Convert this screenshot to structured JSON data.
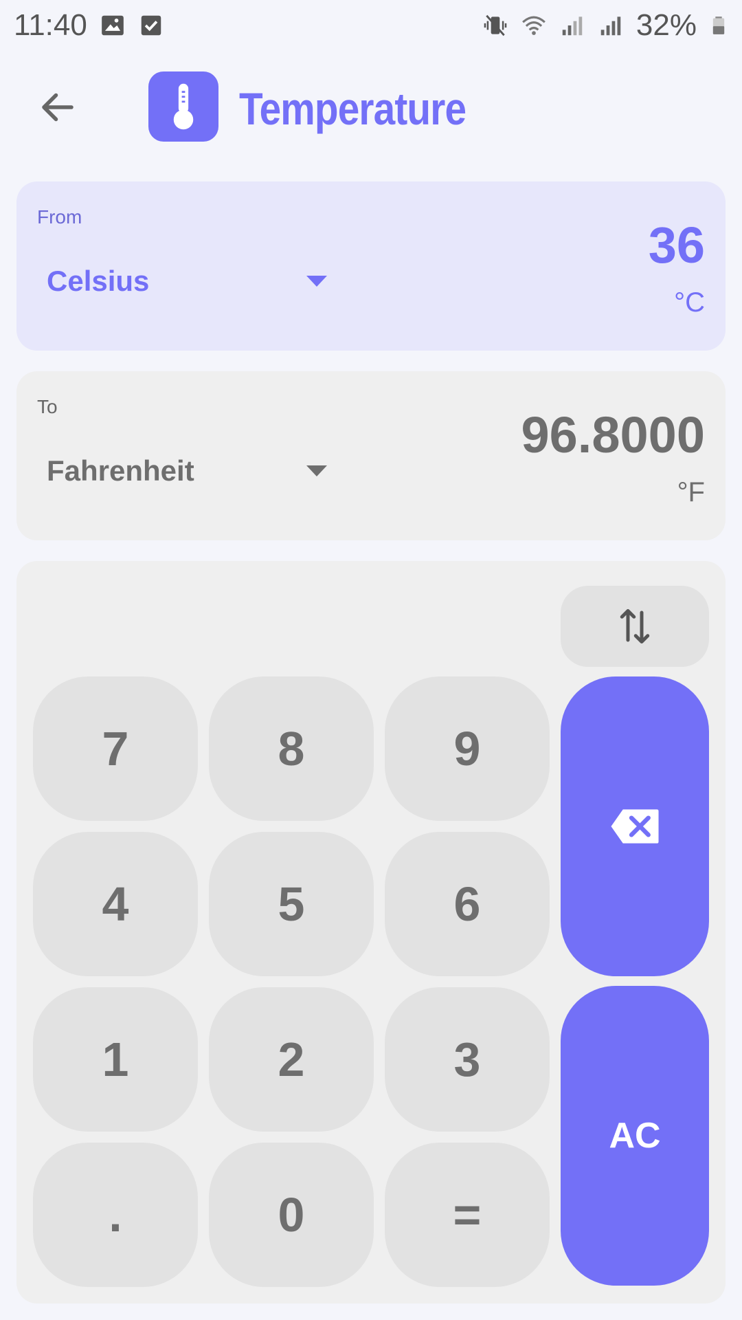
{
  "status_bar": {
    "time": "11:40",
    "battery": "32%",
    "icons": [
      "image-icon",
      "checkbox-icon",
      "vibrate-icon",
      "wifi-icon",
      "signal-icon",
      "signal-icon",
      "battery-icon"
    ]
  },
  "app_bar": {
    "title": "Temperature",
    "icon": "thermometer-icon"
  },
  "from": {
    "label": "From",
    "unit": "Celsius",
    "value": "36",
    "symbol": "°C"
  },
  "to": {
    "label": "To",
    "unit": "Fahrenheit",
    "value": "96.8000",
    "symbol": "°F"
  },
  "keypad": {
    "keys": [
      "7",
      "8",
      "9",
      "4",
      "5",
      "6",
      "1",
      "2",
      "3",
      ".",
      "0",
      "="
    ],
    "clear_label": "AC",
    "swap_icon": "swap-vertical-icon",
    "backspace_icon": "backspace-icon"
  },
  "colors": {
    "accent": "#7370f7",
    "from_card_bg": "#e7e7fb",
    "card_bg": "#efefef",
    "key_bg": "#e2e2e2",
    "key_text": "#6e6e6e",
    "page_bg": "#f4f5fb"
  }
}
